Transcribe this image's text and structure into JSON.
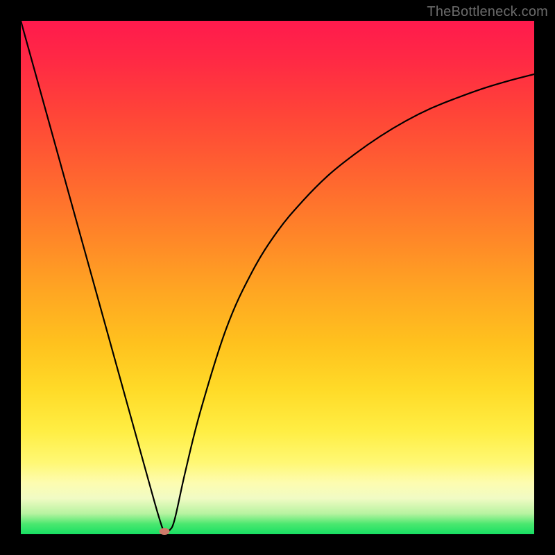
{
  "watermark": "TheBottleneck.com",
  "chart_data": {
    "type": "line",
    "title": "",
    "xlabel": "",
    "ylabel": "",
    "xlim": [
      0,
      100
    ],
    "ylim": [
      0,
      100
    ],
    "grid": false,
    "legend": false,
    "series": [
      {
        "name": "bottleneck-curve",
        "x": [
          0,
          5,
          10,
          15,
          20,
          25,
          27,
          28,
          29,
          30,
          32,
          35,
          40,
          45,
          50,
          55,
          60,
          65,
          70,
          75,
          80,
          85,
          90,
          95,
          100
        ],
        "y": [
          100,
          82,
          64,
          46,
          28,
          10,
          3,
          0.5,
          0.8,
          3,
          12,
          24,
          40,
          51,
          59,
          65,
          70,
          74,
          77.5,
          80.5,
          83,
          85,
          86.8,
          88.3,
          89.6
        ]
      }
    ],
    "annotations": [
      {
        "name": "min-marker",
        "x": 28,
        "y": 0.5
      }
    ],
    "background_gradient": {
      "top": "#ff1a4d",
      "mid": "#ffc21e",
      "bottom": "#17df63"
    }
  }
}
